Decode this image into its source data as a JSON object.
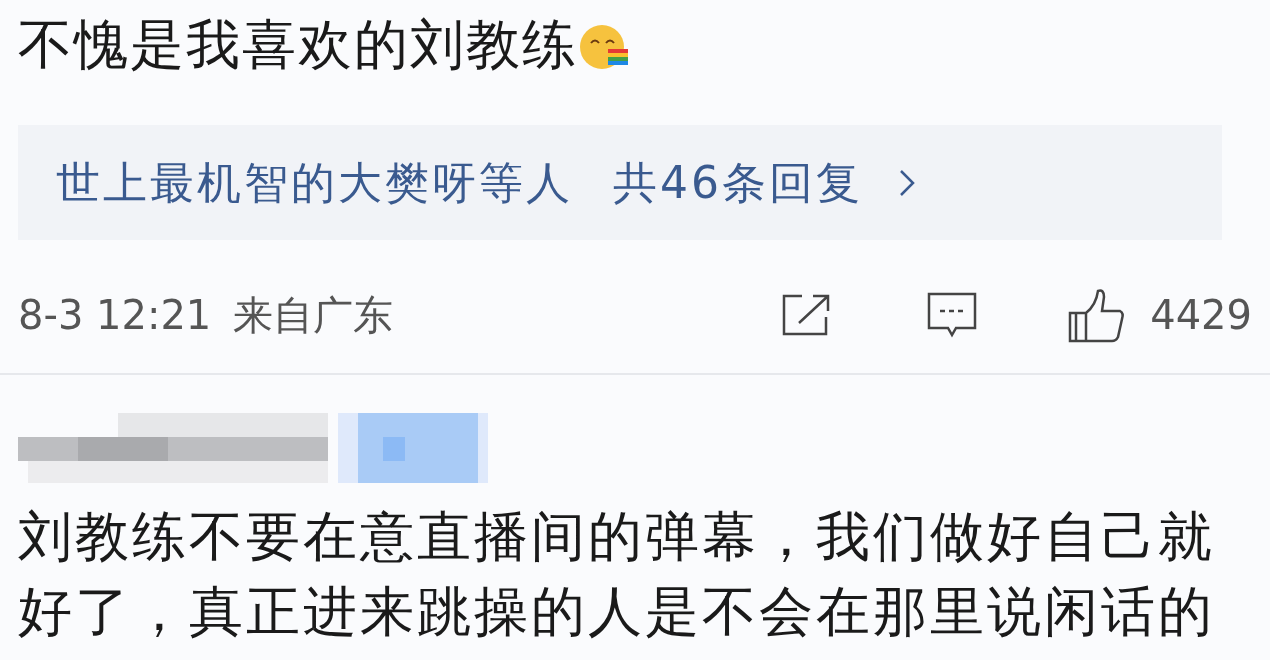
{
  "post": {
    "text": "不愧是我喜欢的刘教练"
  },
  "replies_summary": {
    "names": "世上最机智的大樊呀等人",
    "count": "共46条回复"
  },
  "meta": {
    "time": "8-3 12:21",
    "location": "来自广东"
  },
  "actions": {
    "like_count": "4429"
  },
  "comment": {
    "text": "刘教练不要在意直播间的弹幕，我们做好自己就好了，真正进来跳操的人是不会在那里说闲话的"
  }
}
